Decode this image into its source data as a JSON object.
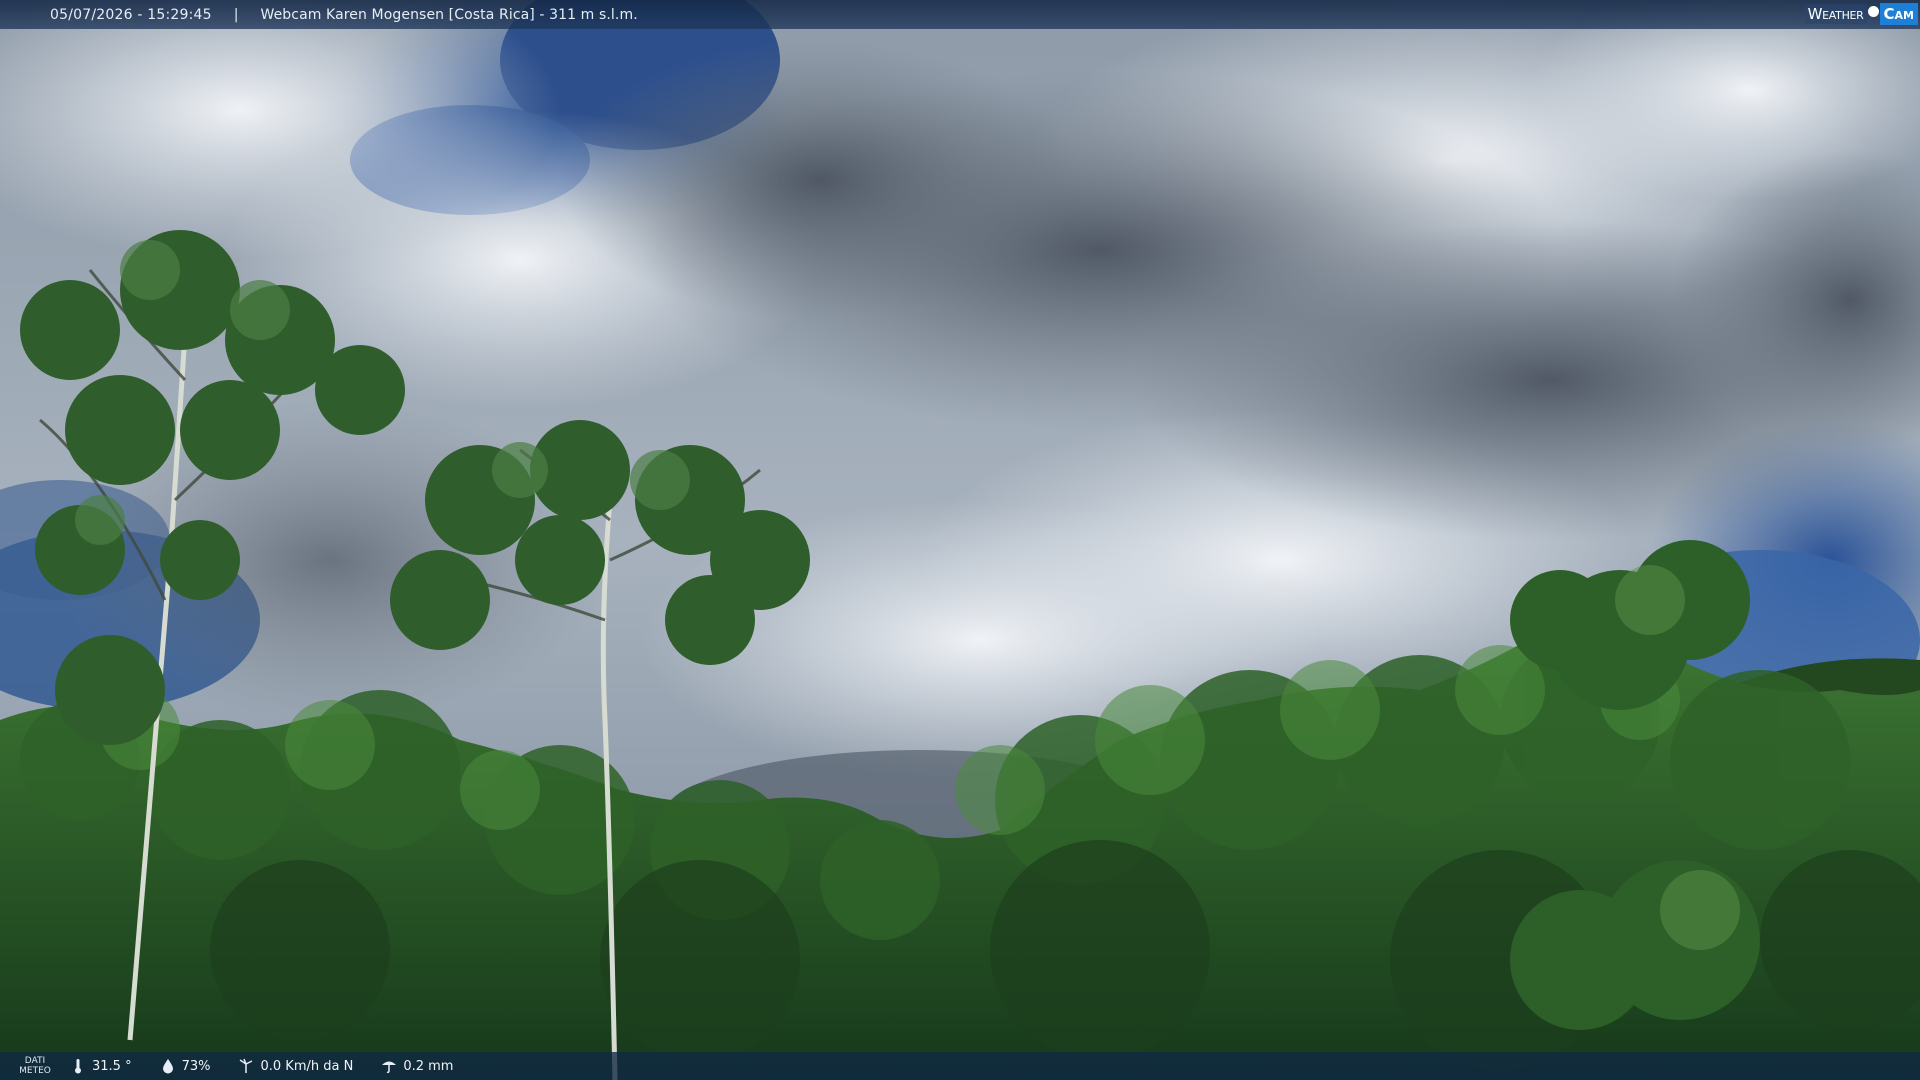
{
  "header": {
    "datetime": "05/07/2026 - 15:29:45",
    "separator": "|",
    "title": "Webcam Karen Mogensen [Costa Rica] - 311 m s.l.m."
  },
  "logo": {
    "part1": "Weather",
    "part2": "Cam"
  },
  "footer": {
    "dati_line1": "DATI",
    "dati_line2": "METEO",
    "temperature": "31.5 °",
    "humidity": "73%",
    "wind": "0.0 Km/h da N",
    "rain": "0.2 mm"
  },
  "icons": {
    "temperature": "thermometer-icon",
    "humidity": "humidity-drop-icon",
    "wind": "wind-icon",
    "rain": "rain-icon"
  },
  "colors": {
    "sky_blue": "#2f5a9c",
    "cloud_light": "#e8edf3",
    "cloud_dark": "#5b6470",
    "foliage": "#2f6a2a",
    "bar": "#13304f"
  }
}
